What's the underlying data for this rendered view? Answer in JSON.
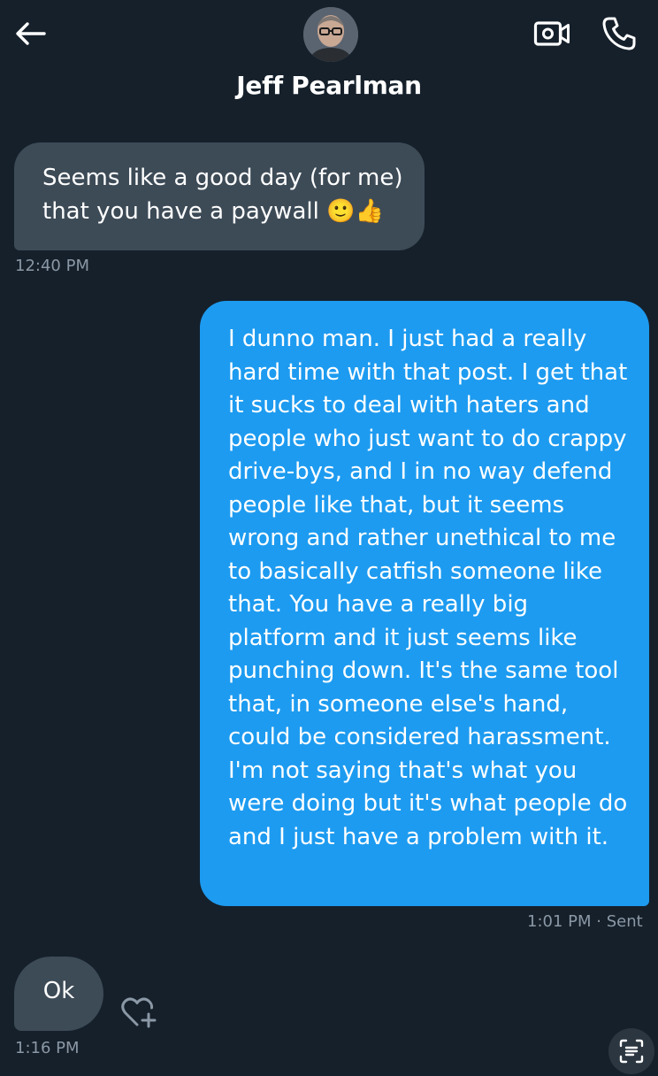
{
  "header": {
    "contact_name": "Jeff Pearlman",
    "back_icon": "arrow-left-icon",
    "video_icon": "video-camera-icon",
    "call_icon": "phone-icon"
  },
  "messages": [
    {
      "direction": "incoming",
      "text": "Seems like a good day (for me) that you have a paywall 🙂👍",
      "time": "12:40 PM"
    },
    {
      "direction": "outgoing",
      "text": "I dunno man. I just had a really hard time with that post. I get that it sucks to deal with haters and people who just want to do crappy drive-bys, and I in no way defend people like that, but it seems wrong and rather unethical to me to basically catfish someone like that. You have a really big platform and it just seems like punching down. It's the same tool that, in someone else's hand, could be considered harassment. I'm not saying that's what you were doing but it's what people do and I just have a problem with it.",
      "time": "1:01 PM",
      "status": "· Sent"
    },
    {
      "direction": "incoming",
      "text": "Ok",
      "time": "1:16 PM"
    }
  ],
  "colors": {
    "background": "#15202b",
    "incoming_bubble": "#3d4b57",
    "outgoing_bubble": "#1d9bf0",
    "timestamp": "#8b98a5"
  }
}
